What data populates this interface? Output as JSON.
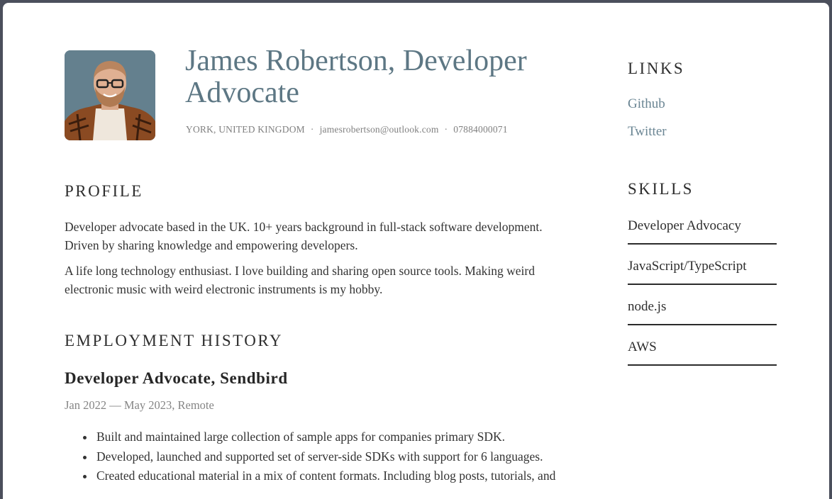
{
  "header": {
    "name": "James Robertson, Developer Advocate",
    "location": "YORK, UNITED KINGDOM",
    "email": "jamesrobertson@outlook.com",
    "phone": "07884000071",
    "separator": "·",
    "avatar_icon": "profile-photo"
  },
  "profile": {
    "title": "PROFILE",
    "paragraphs": [
      "Developer advocate based in the UK. 10+ years background in full-stack software development. Driven by sharing knowledge and empowering developers.",
      "A life long technology enthusiast. I love building and sharing open source tools. Making weird electronic music with weird electronic instruments is my hobby."
    ]
  },
  "employment": {
    "title": "EMPLOYMENT HISTORY",
    "jobs": [
      {
        "title": "Developer Advocate, Sendbird",
        "meta": "Jan 2022 — May 2023, Remote",
        "bullets": [
          "Built and maintained large collection of sample apps for companies primary SDK.",
          "Developed, launched and supported set of server-side SDKs with support for 6 languages.",
          "Created educational material in a mix of content formats. Including blog posts, tutorials, and"
        ]
      }
    ]
  },
  "links": {
    "title": "LINKS",
    "items": [
      "Github",
      "Twitter"
    ]
  },
  "skills": {
    "title": "SKILLS",
    "items": [
      "Developer Advocacy",
      "JavaScript/TypeScript",
      "node.js",
      "AWS"
    ]
  },
  "colors": {
    "accent": "#5d7784",
    "link": "#6a8593",
    "muted": "#808080",
    "text": "#333333",
    "frame": "#4b4f5c"
  }
}
